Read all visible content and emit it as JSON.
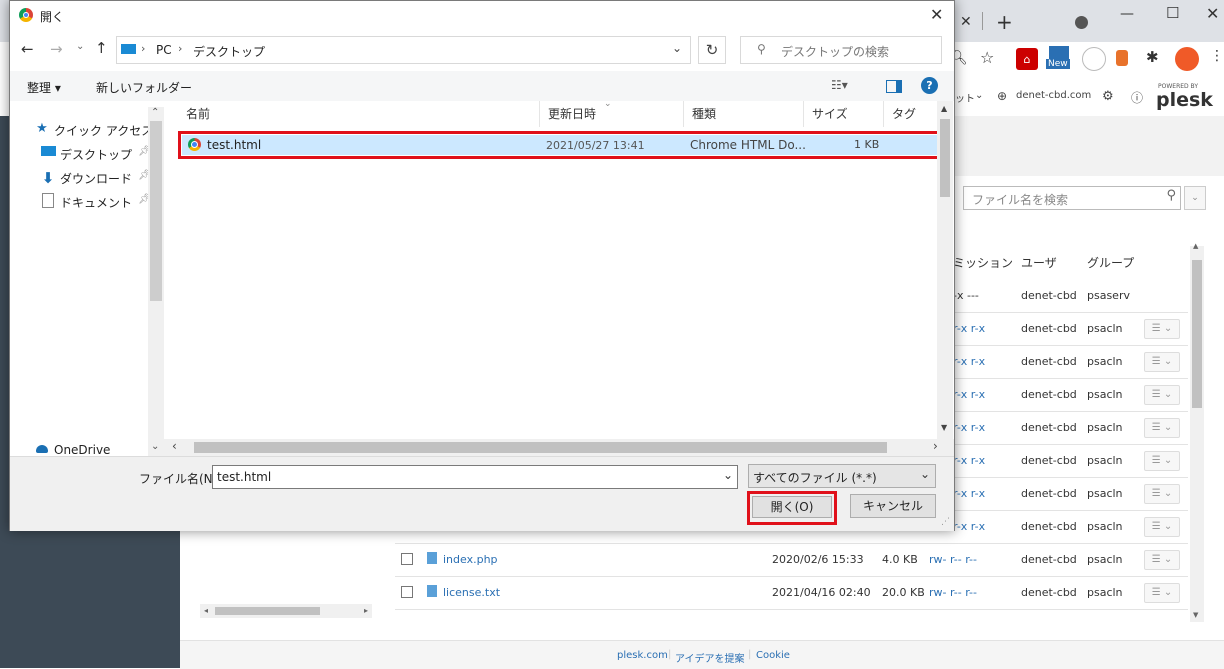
{
  "dialog": {
    "title": "開く",
    "breadcrumb": [
      "PC",
      "デスクトップ"
    ],
    "search_placeholder": "デスクトップの検索",
    "cmd_organize": "整理 ▾",
    "cmd_new_folder": "新しいフォルダー",
    "nav_items": [
      {
        "label": "クイック アクセス",
        "icon": "star-icon"
      },
      {
        "label": "デスクトップ",
        "icon": "desktop-icon"
      },
      {
        "label": "ダウンロード",
        "icon": "download-icon"
      },
      {
        "label": "ドキュメント",
        "icon": "document-icon"
      }
    ],
    "nav_onedrive": "OneDrive",
    "columns": [
      "名前",
      "更新日時",
      "種類",
      "サイズ",
      "タグ"
    ],
    "files": [
      {
        "name": "test.html",
        "modified": "2021/05/27 13:41",
        "type": "Chrome HTML Do...",
        "size": "1 KB"
      }
    ],
    "filename_label": "ファイル名(N):",
    "filename_value": "test.html",
    "filetype_value": "すべてのファイル (*.*)",
    "open_button": "開く(O)",
    "cancel_button": "キャンセル"
  },
  "browser": {
    "extension_new_badge": "New",
    "avatar_color": "#f05a28"
  },
  "plesk": {
    "domain_fragment": "ット",
    "domain": "denet-cbd.com",
    "powered_by": "POWERED BY",
    "logo": "plesk",
    "search_placeholder": "ファイル名を検索",
    "columns": [
      "ミッション",
      "ユーザ",
      "グループ"
    ],
    "rows": [
      {
        "perm": "-x ---",
        "user": "denet-cbd",
        "group": "psaserv"
      },
      {
        "perm": "r-x r-x",
        "user": "denet-cbd",
        "group": "psacln"
      },
      {
        "perm": "r-x r-x",
        "user": "denet-cbd",
        "group": "psacln"
      },
      {
        "perm": "r-x r-x",
        "user": "denet-cbd",
        "group": "psacln"
      },
      {
        "perm": "r-x r-x",
        "user": "denet-cbd",
        "group": "psacln"
      },
      {
        "perm": "r-x r-x",
        "user": "denet-cbd",
        "group": "psacln"
      },
      {
        "perm": "r-x r-x",
        "user": "denet-cbd",
        "group": "psacln"
      },
      {
        "perm": "r-x r-x",
        "user": "denet-cbd",
        "group": "psacln"
      }
    ],
    "files": [
      {
        "name": "index.php",
        "date": "2020/02/6 15:33",
        "size": "4.0 KB",
        "perm": "rw- r-- r--",
        "user": "denet-cbd",
        "group": "psacln"
      },
      {
        "name": "license.txt",
        "date": "2021/04/16 02:40",
        "size": "20.0 KB",
        "perm": "rw- r-- r--",
        "user": "denet-cbd",
        "group": "psacln"
      }
    ],
    "footer": [
      "plesk.com",
      "アイデアを提案",
      "Cookie"
    ]
  }
}
